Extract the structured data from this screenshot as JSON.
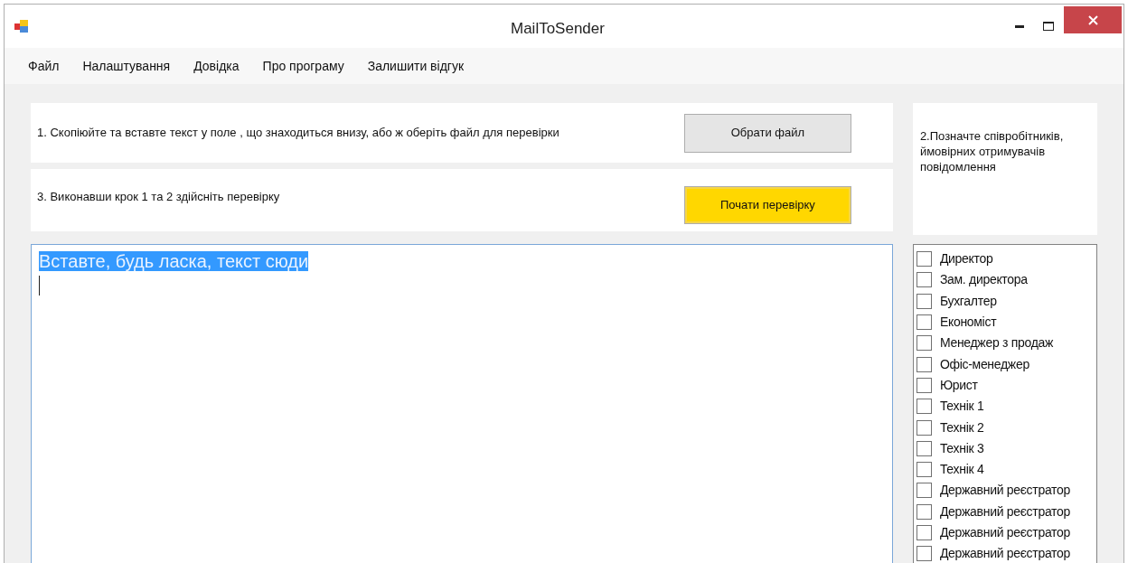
{
  "window": {
    "title": "MailToSender"
  },
  "menu": [
    "Файл",
    "Налаштування",
    "Довідка",
    "Про програму",
    "Залишити відгук"
  ],
  "step1": {
    "text": "1. Скопіюйте та вставте текст у поле , що знаходиться внизу, або ж оберіть файл для перевірки",
    "button": "Обрати файл"
  },
  "step3": {
    "text": "3. Виконавши крок 1 та 2 здійсніть перевірку",
    "button": "Почати перевірку"
  },
  "step2": {
    "text": "2.Позначте співробітників, ймовірних отримувачів повідомлення"
  },
  "editor": {
    "text": "Вставте, будь ласка, текст сюди",
    "selected": true
  },
  "recipients": [
    {
      "label": "Директор",
      "checked": false
    },
    {
      "label": "Зам. директора",
      "checked": false
    },
    {
      "label": "Бухгалтер",
      "checked": false
    },
    {
      "label": "Економіст",
      "checked": false
    },
    {
      "label": "Менеджер з продаж",
      "checked": false
    },
    {
      "label": "Офіс-менеджер",
      "checked": false
    },
    {
      "label": "Юрист",
      "checked": false
    },
    {
      "label": "Технік 1",
      "checked": false
    },
    {
      "label": "Технік 2",
      "checked": false
    },
    {
      "label": "Технік 3",
      "checked": false
    },
    {
      "label": "Технік 4",
      "checked": false
    },
    {
      "label": "Державний реєстратор",
      "checked": false
    },
    {
      "label": "Державний реєстратор",
      "checked": false
    },
    {
      "label": "Державний реєстратор",
      "checked": false
    },
    {
      "label": "Державний реєстратор",
      "checked": false
    }
  ]
}
